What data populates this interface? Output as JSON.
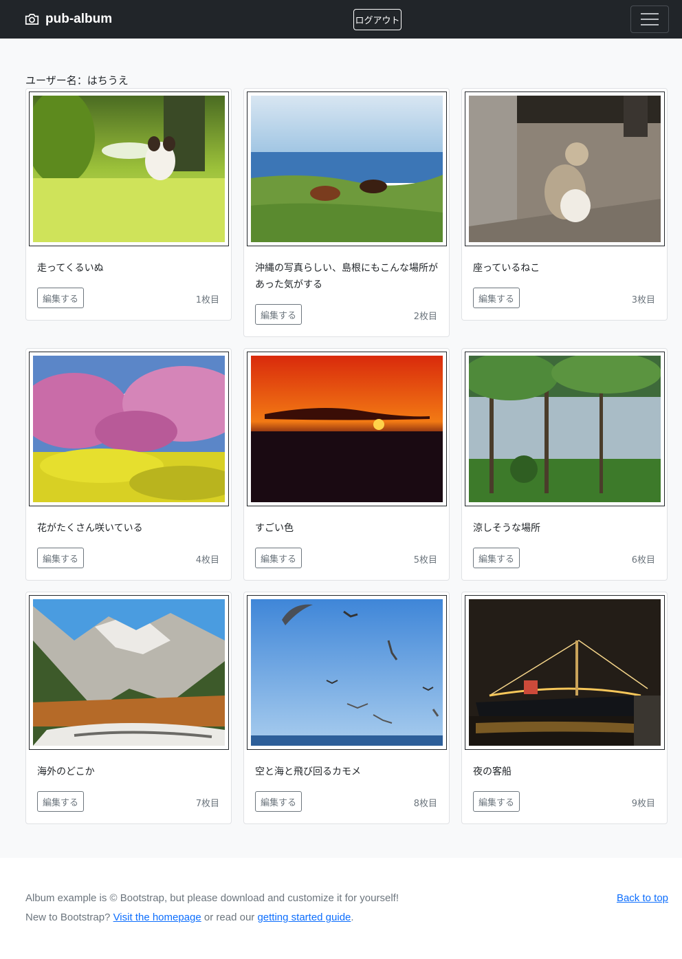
{
  "header": {
    "brand": "pub-album",
    "logout_label": "ログアウト"
  },
  "album": {
    "username_label": "ユーザー名：はちうえ",
    "edit_label": "編集する",
    "cards": [
      {
        "caption": "走ってくるいぬ",
        "count": "1枚目"
      },
      {
        "caption": "沖縄の写真らしい、島根にもこんな場所があった気がする",
        "count": "2枚目"
      },
      {
        "caption": "座っているねこ",
        "count": "3枚目"
      },
      {
        "caption": "花がたくさん咲いている",
        "count": "4枚目"
      },
      {
        "caption": "すごい色",
        "count": "5枚目"
      },
      {
        "caption": "涼しそうな場所",
        "count": "6枚目"
      },
      {
        "caption": "海外のどこか",
        "count": "7枚目"
      },
      {
        "caption": "空と海と飛び回るカモメ",
        "count": "8枚目"
      },
      {
        "caption": "夜の客船",
        "count": "9枚目"
      }
    ]
  },
  "footer": {
    "line1": "Album example is © Bootstrap, but please download and customize it for yourself!",
    "line2_prefix": "New to Bootstrap?",
    "link_homepage": "Visit the homepage",
    "line2_middle": "or read our",
    "link_guide": "getting started guide",
    "line2_suffix": ".",
    "back_to_top": "Back to top"
  }
}
